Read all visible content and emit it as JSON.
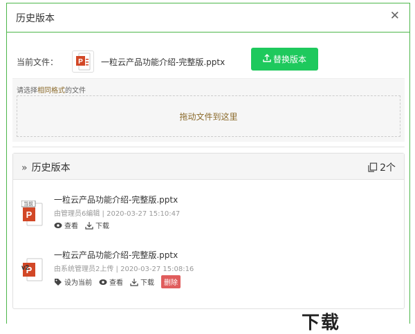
{
  "dialog": {
    "title": "历史版本",
    "close_glyph": "✕"
  },
  "current_file": {
    "label": "当前文件：",
    "name": "一粒云产品功能介绍-完整版.pptx",
    "icon": "pptx-file-icon"
  },
  "replace_button": {
    "icon": "upload-icon",
    "label": "替换版本"
  },
  "drop_zone": {
    "hint_prefix": "请选择",
    "hint_bold": "相同格式",
    "hint_suffix": "的文件",
    "text": "拖动文件到这里"
  },
  "history": {
    "title": "历史版本",
    "count": "2个",
    "versions": [
      {
        "name": "一粒云产品功能介绍-完整版.pptx",
        "meta": "由管理员6编辑 | 2020-03-27 15:10:47",
        "badge": "当前",
        "actions": {
          "view": "查看",
          "download": "下载"
        }
      },
      {
        "name": "一粒云产品功能介绍-完整版.pptx",
        "meta": "由系统管理员2上传 | 2020-03-27 15:08:16",
        "badge": "v2",
        "actions": {
          "set_current": "设为当前",
          "view": "查看",
          "download": "下载",
          "delete": "删除"
        }
      }
    ]
  },
  "watermark": "下载"
}
